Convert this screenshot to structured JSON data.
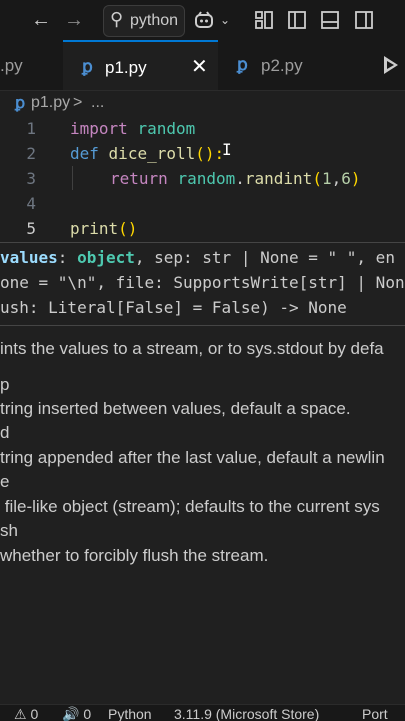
{
  "titlebar": {
    "search_text": "python",
    "icons": [
      "back-arrow-icon",
      "forward-arrow-icon",
      "search-icon",
      "copilot-icon",
      "customize-layout-icon",
      "toggle-sidebar-icon",
      "toggle-panel-icon",
      "toggle-secondary-sidebar-icon"
    ]
  },
  "tabs": [
    {
      "label": ".py",
      "active": false
    },
    {
      "label": "p1.py",
      "active": true
    },
    {
      "label": "p2.py",
      "active": false
    }
  ],
  "breadcrumb": {
    "file": "p1.py",
    "separator": ">",
    "more": "..."
  },
  "editor": {
    "line_numbers": [
      "1",
      "2",
      "3",
      "4",
      "5"
    ],
    "line1": {
      "kw": "import",
      "mod": "random"
    },
    "line2": {
      "kw": "def",
      "fn": "dice_roll",
      "paren": "():"
    },
    "line3": {
      "kw": "return",
      "mod": "random",
      "dot": ".",
      "fn": "randint",
      "open": "(",
      "a": "1",
      "comma": ",",
      "b": "6",
      "close": ")"
    },
    "line5": {
      "fn": "print",
      "paren": "()"
    },
    "cursor": "I"
  },
  "hover": {
    "sig1": {
      "param": "values",
      "colon": ": ",
      "type": "object",
      "rest": ", sep: str | None = \" \", en"
    },
    "sig2": "one = \"\\n\", file: SupportsWrite[str] | Non",
    "sig3": "ush: Literal[False] = False) -> None",
    "doc": [
      "ints the values to a stream, or to sys.stdout by defa",
      "p",
      "tring inserted between values, default a space.",
      "d",
      "tring appended after the last value, default a newlin",
      "e",
      " file-like object (stream); defaults to the current sys",
      "sh",
      "whether to forcibly flush the stream."
    ]
  },
  "statusbar": {
    "warnings": "⚠ 0",
    "ports": "🔊 0",
    "language": "Python",
    "interpreter": "3.11.9 (Microsoft Store)",
    "port_label": "Port"
  },
  "colors": {
    "accent": "#0078d4",
    "keyword": "#c586c0",
    "function": "#dcdcaa",
    "module": "#4ec9b0"
  }
}
